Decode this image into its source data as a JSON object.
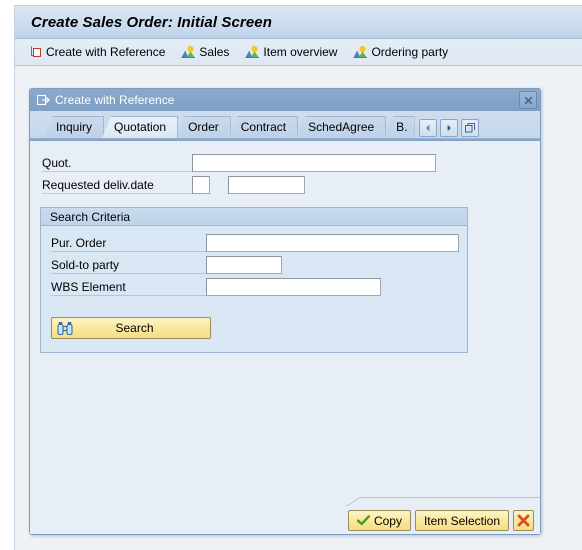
{
  "page": {
    "title": "Create Sales Order: Initial Screen",
    "toolbar": [
      {
        "label": "Create with Reference",
        "icon": "document-reference-icon"
      },
      {
        "label": "Sales",
        "icon": "mountain-sun-icon"
      },
      {
        "label": "Item overview",
        "icon": "mountain-sun-icon"
      },
      {
        "label": "Ordering party",
        "icon": "mountain-sun-icon"
      }
    ]
  },
  "dialog": {
    "title": "Create with Reference",
    "title_icon": "dialog-window-icon",
    "close_icon": "close-icon",
    "tabs": [
      {
        "label": "Inquiry",
        "active": false
      },
      {
        "label": "Quotation",
        "active": true
      },
      {
        "label": "Order",
        "active": false
      },
      {
        "label": "Contract",
        "active": false
      },
      {
        "label": "SchedAgree",
        "active": false
      },
      {
        "label": "B.",
        "active": false
      }
    ],
    "tab_nav": {
      "prev_icon": "arrow-left-icon",
      "next_icon": "arrow-right-icon",
      "list_icon": "tab-list-icon"
    },
    "fields": {
      "quot": {
        "label": "Quot.",
        "value": "",
        "placeholder": ""
      },
      "requested_deliv_date": {
        "label": "Requested deliv.date",
        "prefix_value": "",
        "prefix_placeholder": "",
        "date_value": "",
        "date_placeholder": ""
      }
    },
    "search_criteria": {
      "title": "Search Criteria",
      "fields": [
        {
          "label": "Pur. Order",
          "value": "",
          "placeholder": "",
          "width": "w-pur"
        },
        {
          "label": "Sold-to party",
          "value": "",
          "placeholder": "",
          "width": "w-sold"
        },
        {
          "label": "WBS Element",
          "value": "",
          "placeholder": "",
          "width": "w-wbs"
        }
      ],
      "search_button": {
        "label": "Search",
        "icon": "binoculars-icon"
      }
    },
    "footer": {
      "copy": {
        "label": "Copy",
        "icon": "check-icon"
      },
      "item_selection": {
        "label": "Item Selection"
      },
      "cancel": {
        "label": "",
        "icon": "cancel-x-icon"
      }
    }
  },
  "colors": {
    "accent_blue": "#7e9cc0",
    "title_gradient_top": "#dbe6f2",
    "button_yellow": "#fae89e",
    "check_green": "#4e9a1e",
    "cancel_red": "#d94e1f",
    "group_bg": "#d9e6f3"
  }
}
